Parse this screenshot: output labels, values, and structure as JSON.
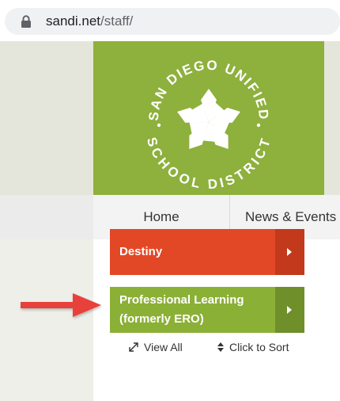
{
  "browser": {
    "url_host": "sandi.net",
    "url_path": "/staff/"
  },
  "logo": {
    "top_text": "SAN DIEGO UNIFIED",
    "bottom_text": "SCHOOL DISTRICT",
    "colors": {
      "banner": "#8eb03d",
      "logo": "#ffffff"
    }
  },
  "nav": {
    "items": [
      {
        "label": "Home"
      },
      {
        "label": "News & Events"
      }
    ]
  },
  "links": [
    {
      "label": "Destiny",
      "color": "#e24826"
    },
    {
      "label_line1": "Professional Learning",
      "label_line2": "(formerly ERO)",
      "color": "#8bb036"
    }
  ],
  "tools": {
    "view_all": "View All",
    "sort": "Click to Sort"
  },
  "annotation": {
    "arrow_color": "#e8413a"
  },
  "icons": [
    "lock-icon",
    "expand-icon",
    "sort-icon",
    "chevron-right-icon",
    "red-arrow-icon"
  ]
}
